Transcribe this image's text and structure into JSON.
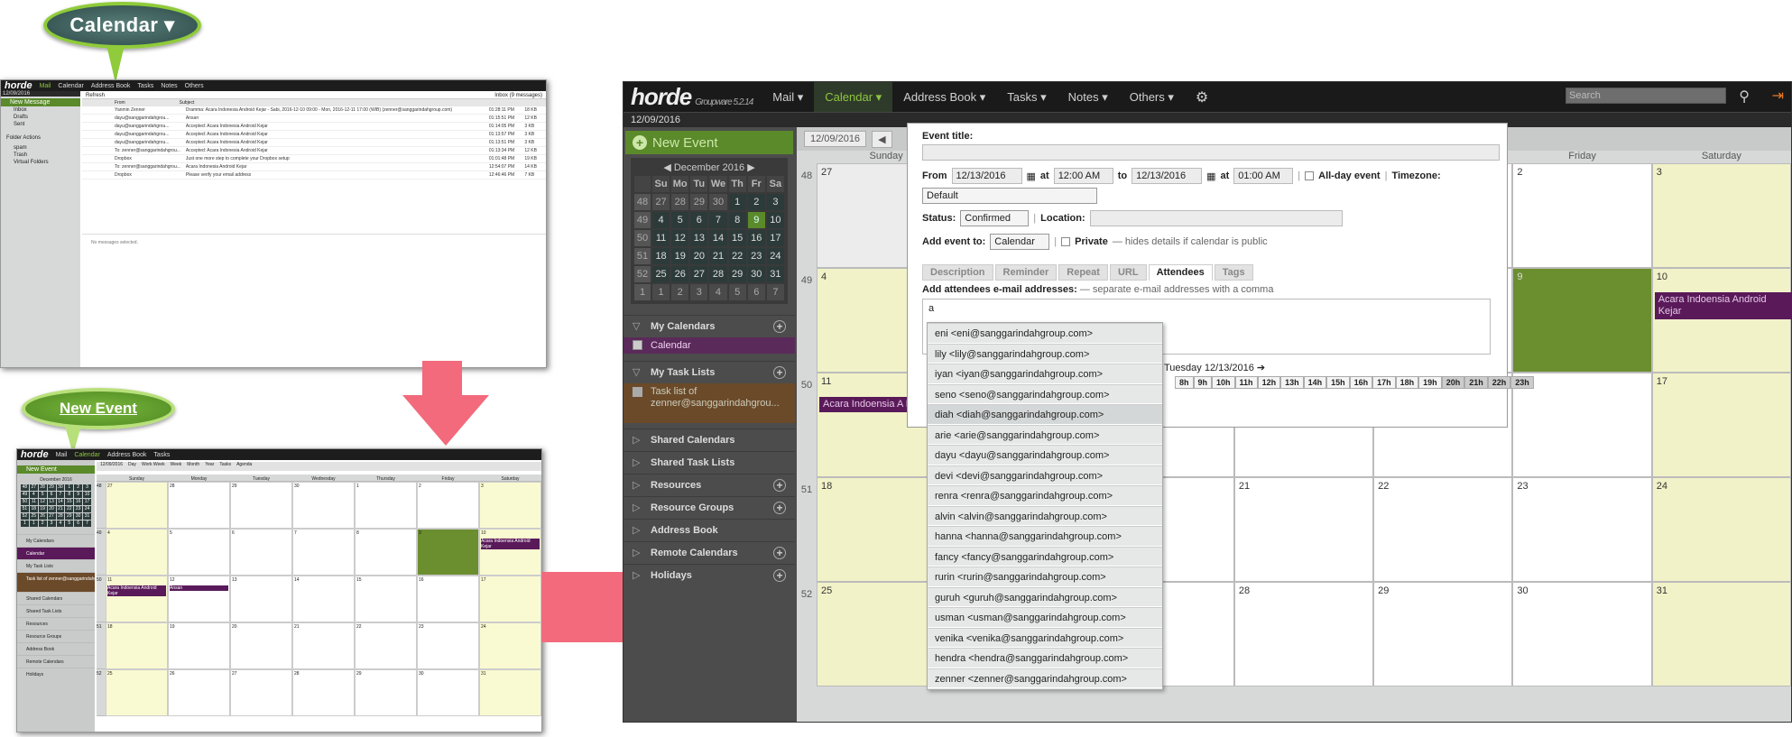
{
  "callouts": {
    "calendar": "Calendar ▾",
    "new_event": "New Event"
  },
  "thumb1": {
    "menu": [
      "Mail",
      "Calendar",
      "Address Book",
      "Tasks",
      "Notes",
      "Others"
    ],
    "date": "12/09/2016",
    "new_message": "New Message",
    "folders": [
      "Inbox",
      "Drafts",
      "Sent"
    ],
    "folder_actions": "Folder Actions",
    "other_folders": [
      "spam",
      "Trash",
      "Virtual Folders"
    ],
    "refresh": "Refresh",
    "inbox_count": "Inbox (9 messages)",
    "headers": [
      "From",
      "Subject",
      "Date",
      "Size"
    ],
    "rows": [
      [
        "Yanmin Zenner",
        "Dramma: Acara Indonesia Android Kejar - Sabi, 2016-12-10 09:00 - Mon, 2016-12-11 17:00 (WIB) (zenner@sanggarindahgroup.com)",
        "01:28:11 PM",
        "18 KB"
      ],
      [
        "dayu@sanggarindahgrou...",
        "Ansan",
        "01:15:51 PM",
        "12 KB"
      ],
      [
        "dayu@sanggarindahgrou...",
        "Accepted: Acara Indonesia Android Kejar",
        "01:14:05 PM",
        "3 KB"
      ],
      [
        "dayu@sanggarindahgrou...",
        "Accepted: Acara Indonesia Android Kejar",
        "01:13:57 PM",
        "3 KB"
      ],
      [
        "dayu@sanggarindahgrou...",
        "Accepted: Acara Indonesia Android Kejar",
        "01:13:51 PM",
        "3 KB"
      ],
      [
        "To: zenner@sanggarindahgrou...",
        "Accepted: Acara Indonesia Android Kejar",
        "01:13:34 PM",
        "12 KB"
      ],
      [
        "Dropbox",
        "Just one more step to complete your Dropbox setup",
        "01:01:48 PM",
        "19 KB"
      ],
      [
        "To: zenner@sanggarindahgrou...",
        "Acara Indonesia Android Kejar",
        "12:54:07 PM",
        "14 KB"
      ],
      [
        "Dropbox",
        "Please verify your email address",
        "12:46:46 PM",
        "7 KB"
      ]
    ],
    "no_selection": "No messages selected."
  },
  "app": {
    "logo": "horde",
    "version": "Groupware 5.2.14",
    "menu": [
      "Mail ▾",
      "Calendar ▾",
      "Address Book ▾",
      "Tasks ▾",
      "Notes ▾",
      "Others ▾"
    ],
    "search_placeholder": "Search",
    "date": "12/09/2016",
    "new_event": "New Event"
  },
  "minical": {
    "header": "December 2016",
    "days": [
      "Su",
      "Mo",
      "Tu",
      "We",
      "Th",
      "Fr",
      "Sa"
    ],
    "weeks": [
      {
        "w": "48",
        "d": [
          "27",
          "28",
          "29",
          "30",
          "1",
          "2",
          "3"
        ]
      },
      {
        "w": "49",
        "d": [
          "4",
          "5",
          "6",
          "7",
          "8",
          "9",
          "10"
        ]
      },
      {
        "w": "50",
        "d": [
          "11",
          "12",
          "13",
          "14",
          "15",
          "16",
          "17"
        ]
      },
      {
        "w": "51",
        "d": [
          "18",
          "19",
          "20",
          "21",
          "22",
          "23",
          "24"
        ]
      },
      {
        "w": "52",
        "d": [
          "25",
          "26",
          "27",
          "28",
          "29",
          "30",
          "31"
        ]
      },
      {
        "w": "1",
        "d": [
          "1",
          "2",
          "3",
          "4",
          "5",
          "6",
          "7"
        ]
      }
    ]
  },
  "sidebar": {
    "my_calendars": "My Calendars",
    "calendar": "Calendar",
    "my_task_lists": "My Task Lists",
    "task_list": "Task list of zenner@sanggarindahgrou...",
    "sections": [
      "Shared Calendars",
      "Shared Task Lists",
      "Resources",
      "Resource Groups",
      "Address Book",
      "Remote Calendars",
      "Holidays"
    ]
  },
  "view": {
    "date": "12/09/2016",
    "day_headers": [
      "Sunday",
      "Monday",
      "Tuesday",
      "Wednesday",
      "Thursday",
      "Friday",
      "Saturday"
    ],
    "buttons": [
      "Day",
      "Work Week",
      "Week",
      "Month",
      "Year",
      "Tasks",
      "Agenda"
    ],
    "weeks": [
      {
        "w": "48",
        "d": [
          "27",
          "28",
          "29",
          "30",
          "1",
          "2",
          "3"
        ]
      },
      {
        "w": "49",
        "d": [
          "4",
          "5",
          "6",
          "7",
          "8",
          "9",
          "10"
        ]
      },
      {
        "w": "50",
        "d": [
          "11",
          "12",
          "13",
          "14",
          "15",
          "16",
          "17"
        ]
      },
      {
        "w": "51",
        "d": [
          "18",
          "19",
          "20",
          "21",
          "22",
          "23",
          "24"
        ]
      },
      {
        "w": "52",
        "d": [
          "25",
          "26",
          "27",
          "28",
          "29",
          "30",
          "31"
        ]
      }
    ],
    "event": "Acara Indoensia Android Kejar",
    "event2": "Acara Indoensia A Kejar",
    "event3": "Ansan"
  },
  "dialog": {
    "event_title": "Event title:",
    "from": "From",
    "from_date": "12/13/2016",
    "at": "at",
    "from_time": "12:00 AM",
    "to": "to",
    "to_date": "12/13/2016",
    "to_time": "01:00 AM",
    "all_day": "All-day event",
    "timezone": "Timezone:",
    "tz_value": "Default",
    "status": "Status:",
    "status_value": "Confirmed",
    "location": "Location:",
    "add_to": "Add event to:",
    "add_to_value": "Calendar",
    "private": "Private",
    "private_hint": "— hides details if calendar is public",
    "tabs": [
      "Description",
      "Reminder",
      "Repeat",
      "URL",
      "Attendees",
      "Tags"
    ],
    "attendees_label": "Add attendees e-mail addresses:",
    "attendees_hint": "— separate e-mail addresses with a comma",
    "attendees_value": "a",
    "day_label": "Tuesday 12/13/2016",
    "hours": [
      "8h",
      "9h",
      "10h",
      "11h",
      "12h",
      "13h",
      "14h",
      "15h",
      "16h",
      "17h",
      "18h",
      "19h",
      "20h",
      "21h",
      "22h",
      "23h"
    ]
  },
  "autocomplete": [
    "eni <eni@sanggarindahgroup.com>",
    "lily <lily@sanggarindahgroup.com>",
    "iyan <iyan@sanggarindahgroup.com>",
    "seno <seno@sanggarindahgroup.com>",
    "diah <diah@sanggarindahgroup.com>",
    "arie <arie@sanggarindahgroup.com>",
    "dayu <dayu@sanggarindahgroup.com>",
    "devi <devi@sanggarindahgroup.com>",
    "renra <renra@sanggarindahgroup.com>",
    "alvin <alvin@sanggarindahgroup.com>",
    "hanna <hanna@sanggarindahgroup.com>",
    "fancy <fancy@sanggarindahgroup.com>",
    "rurin <rurin@sanggarindahgroup.com>",
    "guruh <guruh@sanggarindahgroup.com>",
    "usman <usman@sanggarindahgroup.com>",
    "venika <venika@sanggarindahgroup.com>",
    "hendra <hendra@sanggarindahgroup.com>",
    "zenner <zenner@sanggarindahgroup.com>"
  ],
  "colors": {
    "accent": "#8cc63f",
    "event": "#5a1a5a",
    "arrow": "#f26a7c"
  }
}
